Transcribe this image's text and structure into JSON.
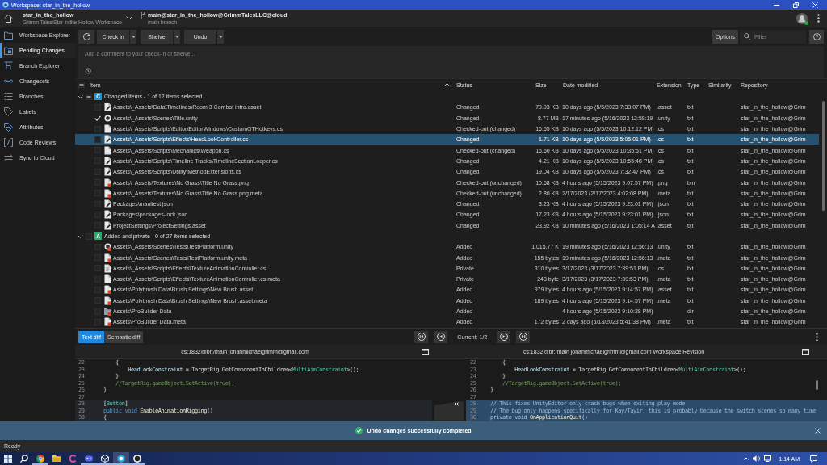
{
  "window": {
    "title": "Workspace: star_in_the_hollow"
  },
  "header": {
    "workspace": {
      "name": "star_in_the_hollow",
      "path": "Grimm Tales\\Star in the Hollow Workspace"
    },
    "branch": {
      "name": "main@star_in_the_hollow@GrimmTalesLLC@cloud",
      "description": "main branch"
    },
    "user": {
      "online": true
    }
  },
  "sidebar": {
    "items": [
      {
        "label": "Workspace Explorer",
        "selected": false
      },
      {
        "label": "Pending Changes",
        "selected": true
      },
      {
        "label": "Branch Explorer",
        "selected": false
      },
      {
        "label": "Changesets",
        "selected": false
      },
      {
        "label": "Branches",
        "selected": false
      },
      {
        "label": "Labels",
        "selected": false
      },
      {
        "label": "Attributes",
        "selected": false
      },
      {
        "label": "Code Reviews",
        "selected": false
      },
      {
        "label": "Sync to Cloud",
        "selected": false
      }
    ]
  },
  "toolbar": {
    "actions": [
      {
        "label": "Check in",
        "menu": true
      },
      {
        "label": "Shelve",
        "menu": true
      },
      {
        "label": "Undo",
        "menu": true
      }
    ],
    "options": "Options",
    "filter": {
      "placeholder": "Filter"
    }
  },
  "comment": {
    "placeholder": "Add a comment to your check-in or shelve..."
  },
  "table": {
    "select_all": {
      "partial": true
    },
    "columns": [
      {
        "label": "Item",
        "sorted": true
      },
      {
        "label": "Status",
        "sorted": false
      },
      {
        "label": "Size",
        "sorted": false
      },
      {
        "label": "Date modified",
        "sorted": false
      },
      {
        "label": "Extension",
        "sorted": false
      },
      {
        "label": "Type",
        "sorted": false
      },
      {
        "label": "Similarity",
        "sorted": false
      },
      {
        "label": "Repository",
        "sorted": false
      }
    ],
    "groups": [
      {
        "label": "Changed items - 1 of 12 items selected",
        "badge": "C",
        "color": "#1d93d2",
        "expanded": true,
        "partial": true,
        "rows": [
          {
            "kind": "edited",
            "item": "Assets\\_Assets\\Data\\Timelines\\Room 3 Combat intro.asset",
            "status": "Changed",
            "size": "79.93 KB",
            "date": "10 days ago (5/5/2023 7:33:07 PM)",
            "extension": ".asset",
            "type": "txt",
            "repository": "star_in_the_hollow@Grim",
            "checked": false,
            "selected": false
          },
          {
            "kind": "scene",
            "item": "Assets\\_Assets\\Scenes\\Title.unity",
            "status": "Changed",
            "size": "8.77 MB",
            "date": "17 minutes ago (5/16/2023 12:58:19",
            "extension": ".unity",
            "type": "txt",
            "repository": "star_in_the_hollow@Grim",
            "checked": true,
            "selected": false
          },
          {
            "kind": "plain",
            "item": "Assets\\_Assets\\Scripts\\Editor\\EditorWindows\\CustomGTHotkeys.cs",
            "status": "Checked-out (changed)",
            "size": "16.55 KB",
            "date": "10 days ago (5/5/2023 10:12:12 PM)",
            "extension": ".cs",
            "type": "txt",
            "repository": "star_in_the_hollow@Grim",
            "checked": false,
            "selected": false
          },
          {
            "kind": "edited",
            "item": "Assets\\_Assets\\Scripts\\Effects\\HeadLookController.cs",
            "status": "Changed",
            "size": "1.71 KB",
            "date": "10 days ago (5/5/2023 5:05:01 PM)",
            "extension": ".cs",
            "type": "txt",
            "repository": "star_in_the_hollow@Grim",
            "checked": false,
            "selected": true
          },
          {
            "kind": "plain",
            "item": "Assets\\_Assets\\Scripts\\Mechanics\\Weapon.cs",
            "status": "Checked-out (changed)",
            "size": "16.60 KB",
            "date": "10 days ago (5/5/2023 10:35:51 PM)",
            "extension": ".cs",
            "type": "txt",
            "repository": "star_in_the_hollow@Grim",
            "checked": false,
            "selected": false
          },
          {
            "kind": "edited",
            "item": "Assets\\_Assets\\Scripts\\Timeline Tracks\\TimelineSectionLooper.cs",
            "status": "Changed",
            "size": "4.21 KB",
            "date": "10 days ago (5/5/2023 10:55:48 PM)",
            "extension": ".cs",
            "type": "txt",
            "repository": "star_in_the_hollow@Grim",
            "checked": false,
            "selected": false
          },
          {
            "kind": "edited",
            "item": "Assets\\_Assets\\Scripts\\Utility\\MethodExtensions.cs",
            "status": "Changed",
            "size": "19.04 KB",
            "date": "10 days ago (5/5/2023 7:32:47 PM)",
            "extension": ".cs",
            "type": "txt",
            "repository": "star_in_the_hollow@Grim",
            "checked": false,
            "selected": false
          },
          {
            "kind": "flagged",
            "item": "Assets\\_Assets\\Textures\\No Grass\\Title No Grass.png",
            "status": "Checked-out (unchanged)",
            "size": "10.68 KB",
            "date": "4 hours ago (5/15/2023 9:07:57 PM)",
            "extension": ".png",
            "type": "bin",
            "repository": "star_in_the_hollow@Grim",
            "checked": false,
            "selected": false
          },
          {
            "kind": "flagged",
            "item": "Assets\\_Assets\\Textures\\No Grass\\Title No Grass.png.meta",
            "status": "Checked-out (unchanged)",
            "size": "2.80 KB",
            "date": "2/17/2023 (2/17/2023 4:02:08 PM)",
            "extension": ".meta",
            "type": "txt",
            "repository": "star_in_the_hollow@Grim",
            "checked": false,
            "selected": false
          },
          {
            "kind": "edited",
            "item": "Packages\\manifest.json",
            "status": "Changed",
            "size": "3.23 KB",
            "date": "4 hours ago (5/15/2023 9:23:01 PM)",
            "extension": ".json",
            "type": "txt",
            "repository": "star_in_the_hollow@Grim",
            "checked": false,
            "selected": false
          },
          {
            "kind": "edited",
            "item": "Packages\\packages-lock.json",
            "status": "Changed",
            "size": "17.23 KB",
            "date": "4 hours ago (5/15/2023 9:23:01 PM)",
            "extension": ".json",
            "type": "txt",
            "repository": "star_in_the_hollow@Grim",
            "checked": false,
            "selected": false
          },
          {
            "kind": "edited",
            "item": "ProjectSettings\\ProjectSettings.asset",
            "status": "Changed",
            "size": "23.92 KB",
            "date": "10 minutes ago (5/16/2023 1:05:14 A",
            "extension": ".asset",
            "type": "txt",
            "repository": "star_in_the_hollow@Grim",
            "checked": false,
            "selected": false
          }
        ]
      },
      {
        "label": "Added and private - 0 of 27 items selected",
        "badge": "A",
        "color": "#2ea86c",
        "expanded": true,
        "partial": false,
        "rows": [
          {
            "kind": "sceneflag",
            "item": "Assets\\_Assets\\Scenes\\Tests\\TestPlatform.unity",
            "status": "Added",
            "size": "1,015.77 K",
            "date": "19 minutes ago (5/16/2023 12:56:13",
            "extension": ".unity",
            "type": "txt",
            "repository": "star_in_the_hollow@Grim",
            "checked": false,
            "selected": false
          },
          {
            "kind": "flagged",
            "item": "Assets\\_Assets\\Scenes\\Tests\\TestPlatform.unity.meta",
            "status": "Added",
            "size": "155 bytes",
            "date": "19 minutes ago (5/16/2023 12:56:13",
            "extension": ".meta",
            "type": "txt",
            "repository": "star_in_the_hollow@Grim",
            "checked": false,
            "selected": false
          },
          {
            "kind": "source",
            "item": "Assets\\_Assets\\Scripts\\Effects\\TextureAnimationController.cs",
            "status": "Private",
            "size": "310 bytes",
            "date": "3/17/2023 (3/17/2023 7:39:51 PM)",
            "extension": ".cs",
            "type": "txt",
            "repository": "star_in_the_hollow@Grim",
            "checked": false,
            "selected": false
          },
          {
            "kind": "plain",
            "item": "Assets\\_Assets\\Scripts\\Effects\\TextureAnimationController.cs.meta",
            "status": "Private",
            "size": "243 byte",
            "date": "3/17/2023 (3/17/2023 7:39:53 PM)",
            "extension": ".meta",
            "type": "txt",
            "repository": "star_in_the_hollow@Grim",
            "checked": false,
            "selected": false
          },
          {
            "kind": "flagged",
            "item": "Assets\\Polybrush Data\\Brush Settings\\New Brush.asset",
            "status": "Added",
            "size": "979 bytes",
            "date": "4 hours ago (5/15/2023 9:14:57 PM)",
            "extension": ".asset",
            "type": "txt",
            "repository": "star_in_the_hollow@Grim",
            "checked": false,
            "selected": false
          },
          {
            "kind": "flagged",
            "item": "Assets\\Polybrush Data\\Brush Settings\\New Brush.asset.meta",
            "status": "Added",
            "size": "189 bytes",
            "date": "4 hours ago (5/15/2023 9:14:57 PM)",
            "extension": ".meta",
            "type": "txt",
            "repository": "star_in_the_hollow@Grim",
            "checked": false,
            "selected": false
          },
          {
            "kind": "folder",
            "item": "Assets\\ProBuilder Data",
            "status": "Added",
            "date": "4 hours ago (5/15/2023 9:10:38 PM)",
            "type": "dir",
            "repository": "star_in_the_hollow@Grim",
            "checked": false,
            "selected": false
          },
          {
            "kind": "flagged",
            "item": "Assets\\ProBuilder Data.meta",
            "status": "Added",
            "size": "172 bytes",
            "date": "2 days ago (5/13/2023 5:41:38 PM)",
            "extension": ".meta",
            "type": "txt",
            "repository": "star_in_the_hollow@Grim",
            "checked": false,
            "selected": false
          }
        ]
      }
    ]
  },
  "diff": {
    "modes": [
      {
        "label": "Text diff",
        "selected": true
      },
      {
        "label": "Semantic diff",
        "selected": false
      }
    ],
    "position": "Current: 1/2",
    "panes": [
      {
        "title": "cs:1832@br:/main jonahmichaelgrimm@gmail.com",
        "lines": [
          {
            "number": "22",
            "changed": false,
            "parts": [
              {
                "text": "        {",
                "kind": "plain"
              }
            ]
          },
          {
            "number": "23",
            "changed": false,
            "parts": [
              {
                "text": "            HeadLookConstraint",
                "kind": "field"
              },
              {
                "text": " = TargetRig.GetComponentInChildren<",
                "kind": "plain"
              },
              {
                "text": "MultiAimConstraint",
                "kind": "type"
              },
              {
                "text": ">();",
                "kind": "plain"
              }
            ]
          },
          {
            "number": "24",
            "changed": false,
            "parts": [
              {
                "text": "        }",
                "kind": "plain"
              }
            ]
          },
          {
            "number": "25",
            "changed": false,
            "parts": [
              {
                "text": "        //TargetRig.gameObject.SetActive(true);",
                "kind": "comment"
              }
            ]
          },
          {
            "number": "26",
            "changed": false,
            "parts": [
              {
                "text": "    }",
                "kind": "plain"
              }
            ]
          },
          {
            "number": "27",
            "changed": false
          },
          {
            "number": "28",
            "changed": true,
            "parts": [
              {
                "text": "    [",
                "kind": "plain"
              },
              {
                "text": "Button",
                "kind": "type"
              },
              {
                "text": "]",
                "kind": "plain"
              }
            ]
          },
          {
            "number": "29",
            "changed": true,
            "parts": [
              {
                "text": "    public void",
                "kind": "keyword"
              },
              {
                "text": " EnableAnimationRigging",
                "kind": "method"
              },
              {
                "text": "()",
                "kind": "plain"
              }
            ]
          },
          {
            "number": "30",
            "changed": true,
            "parts": [
              {
                "text": "    {",
                "kind": "plain"
              }
            ]
          }
        ]
      },
      {
        "title": "cs:1832@br:/main jonahmichaelgrimm@gmail.com Workspace Revision",
        "lines": [
          {
            "number": "22",
            "changed": false,
            "parts": [
              {
                "text": "        {",
                "kind": "plain"
              }
            ]
          },
          {
            "number": "23",
            "changed": false,
            "parts": [
              {
                "text": "            HeadLookConstraint",
                "kind": "field"
              },
              {
                "text": " = TargetRig.GetComponentInChildren<",
                "kind": "plain"
              },
              {
                "text": "MultiAimConstraint",
                "kind": "type"
              },
              {
                "text": ">();",
                "kind": "plain"
              }
            ]
          },
          {
            "number": "24",
            "changed": false,
            "parts": [
              {
                "text": "        }",
                "kind": "plain"
              }
            ]
          },
          {
            "number": "25",
            "changed": false,
            "parts": [
              {
                "text": "        //TargetRig.gameObject.SetActive(true);",
                "kind": "comment"
              }
            ]
          },
          {
            "number": "26",
            "changed": false,
            "parts": [
              {
                "text": "    }",
                "kind": "plain"
              }
            ]
          },
          {
            "number": "27",
            "changed": false
          },
          {
            "number": "28",
            "changed": true,
            "discard": true,
            "parts": [
              {
                "text": "    // This fixes UnityEditor only crash bugs when exiting play mode",
                "kind": "comment"
              }
            ]
          },
          {
            "number": "29",
            "changed": true,
            "parts": [
              {
                "text": "    // The bug only happens specifically for Kay/Tayir, this is probably because the switch scenes so many time",
                "kind": "comment"
              }
            ]
          },
          {
            "number": "30",
            "changed": true,
            "parts": [
              {
                "text": "    private void",
                "kind": "keyword"
              },
              {
                "text": " OnApplicationQuit",
                "kind": "method"
              },
              {
                "text": "()",
                "kind": "plain"
              }
            ]
          }
        ]
      }
    ]
  },
  "toast": {
    "message": "Undo changes successfully completed"
  },
  "status_bar": {
    "text": "Ready"
  },
  "taskbar": {
    "apps": [
      {
        "running": false,
        "active": false
      },
      {
        "running": false,
        "active": false
      },
      {
        "running": true,
        "active": false
      },
      {
        "running": false,
        "active": false
      },
      {
        "running": false,
        "active": false
      },
      {
        "running": true,
        "active": false
      },
      {
        "running": true,
        "active": false
      },
      {
        "running": true,
        "active": true
      },
      {
        "running": true,
        "active": false
      }
    ],
    "clock": "1:14 AM"
  }
}
